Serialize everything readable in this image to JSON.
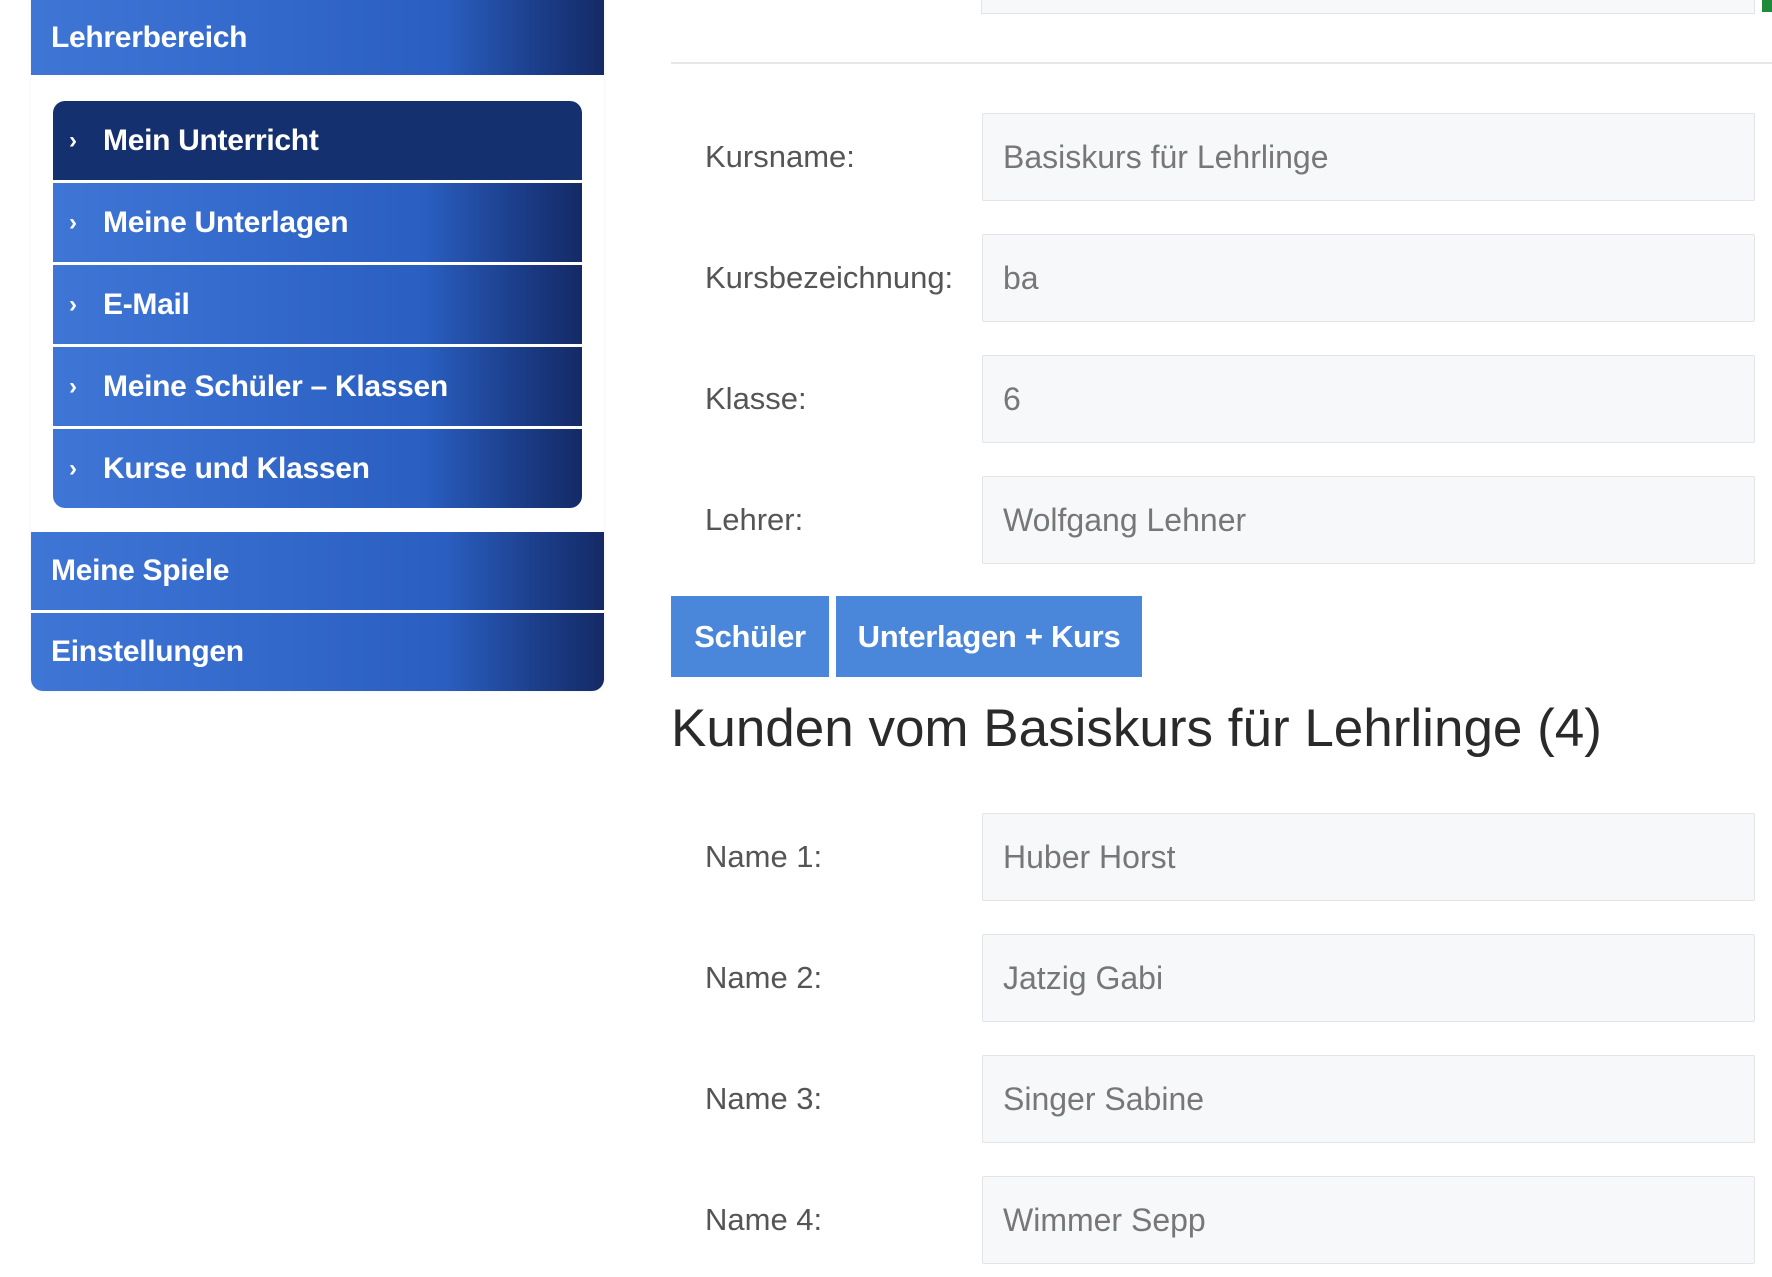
{
  "sidebar": {
    "header": "Lehrerbereich",
    "submenu": [
      {
        "label": "Mein Unterricht",
        "active": true
      },
      {
        "label": "Meine Unterlagen",
        "active": false
      },
      {
        "label": "E-Mail",
        "active": false
      },
      {
        "label": "Meine Schüler – Klassen",
        "active": false
      },
      {
        "label": "Kurse und Klassen",
        "active": false
      }
    ],
    "spiele": "Meine Spiele",
    "einstellungen": "Einstellungen",
    "chevron_icon": "chevron-right-icon"
  },
  "course": {
    "fields": [
      {
        "label": "Kursname:",
        "value": "Basiskurs für Lehrlinge"
      },
      {
        "label": "Kursbezeichnung:",
        "value": "ba"
      },
      {
        "label": "Klasse:",
        "value": "6"
      },
      {
        "label": "Lehrer:",
        "value": "Wolfgang Lehner"
      }
    ]
  },
  "buttons": {
    "students": "Schüler",
    "materials": "Unterlagen + Kurs"
  },
  "students_section": {
    "title": "Kunden vom Basiskurs für Lehrlinge (4)",
    "names": [
      {
        "label": "Name 1:",
        "value": "Huber Horst"
      },
      {
        "label": "Name 2:",
        "value": "Jatzig Gabi"
      },
      {
        "label": "Name 3:",
        "value": "Singer Sabine"
      },
      {
        "label": "Name 4:",
        "value": "Wimmer Sepp"
      }
    ]
  },
  "colors": {
    "nav_blue": "#2a5fc1",
    "nav_dark": "#142a66",
    "active_item": "#15306e",
    "button_blue": "#4a86d9"
  }
}
